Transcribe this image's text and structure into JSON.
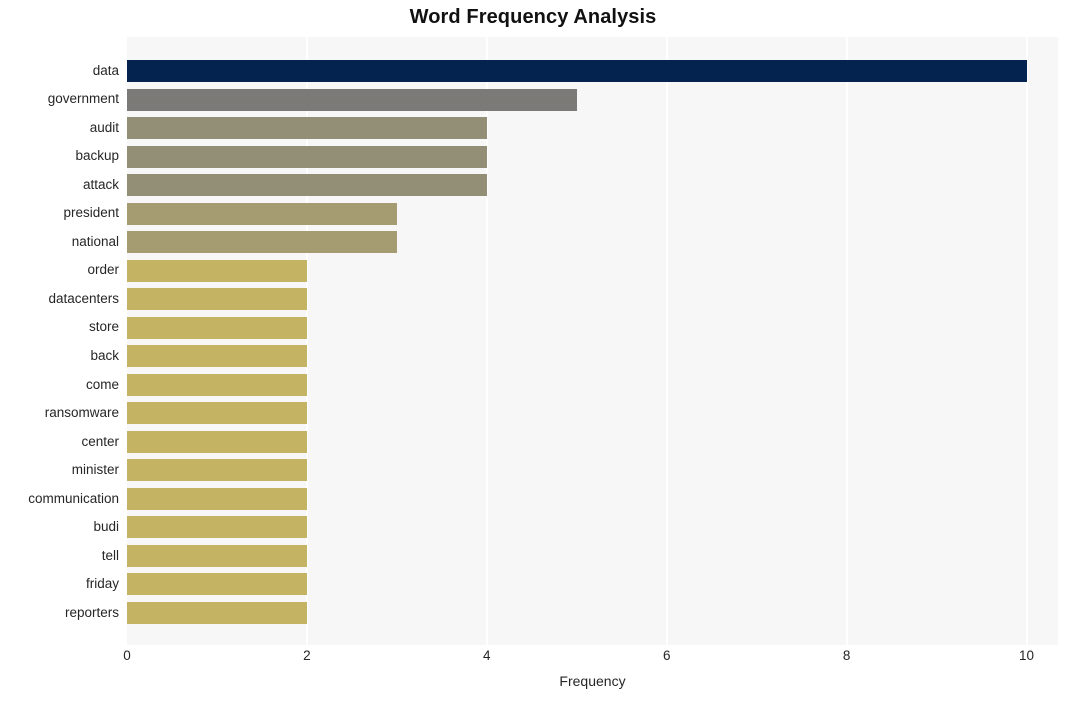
{
  "chart_data": {
    "type": "bar",
    "orientation": "horizontal",
    "title": "Word Frequency Analysis",
    "xlabel": "Frequency",
    "ylabel": "",
    "categories": [
      "data",
      "government",
      "audit",
      "backup",
      "attack",
      "president",
      "national",
      "order",
      "datacenters",
      "store",
      "back",
      "come",
      "ransomware",
      "center",
      "minister",
      "communication",
      "budi",
      "tell",
      "friday",
      "reporters"
    ],
    "values": [
      10,
      5,
      4,
      4,
      4,
      3,
      3,
      2,
      2,
      2,
      2,
      2,
      2,
      2,
      2,
      2,
      2,
      2,
      2,
      2
    ],
    "bar_colors": [
      "#04234f",
      "#7b7a76",
      "#938e76",
      "#938e76",
      "#938e76",
      "#a59c72",
      "#a59c72",
      "#c4b363",
      "#c4b363",
      "#c4b363",
      "#c4b363",
      "#c4b363",
      "#c4b363",
      "#c4b363",
      "#c4b363",
      "#c4b363",
      "#c4b363",
      "#c4b363",
      "#c4b363",
      "#c4b363"
    ],
    "xlim": [
      0,
      10.35
    ],
    "xticks": [
      0,
      2,
      4,
      6,
      8,
      10
    ],
    "xtick_labels": [
      "0",
      "2",
      "4",
      "6",
      "8",
      "10"
    ],
    "grid": "vertical",
    "grid_color": "#ffffff",
    "plot_background": "#f7f7f7",
    "figure_background": "#ffffff",
    "legend": "none"
  }
}
